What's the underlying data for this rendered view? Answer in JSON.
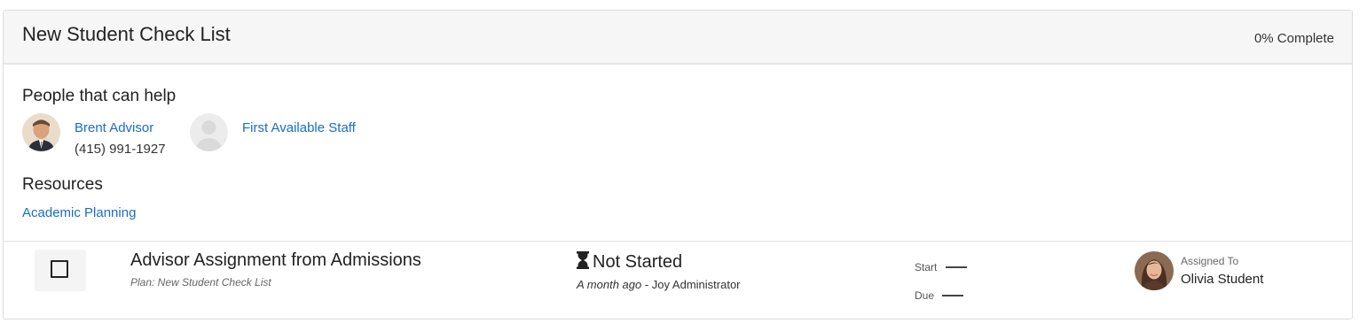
{
  "card": {
    "title": "New Student Check List",
    "progress": "0% Complete"
  },
  "people": {
    "heading": "People that can help",
    "items": [
      {
        "name": "Brent Advisor",
        "phone": "(415) 991-1927",
        "avatar": "advisor-photo"
      },
      {
        "name": "First Available Staff",
        "avatar": "placeholder-person-icon"
      }
    ]
  },
  "resources": {
    "heading": "Resources",
    "items": [
      {
        "label": "Academic Planning"
      }
    ]
  },
  "task": {
    "title": "Advisor Assignment from Admissions",
    "plan": "Plan: New Student Check List",
    "status": "Not Started",
    "status_icon": "hourglass-icon",
    "when": "A month ago",
    "separator": " - ",
    "by": "Joy Administrator",
    "start_label": "Start",
    "due_label": "Due",
    "assigned_label": "Assigned To",
    "assignee": "Olivia Student"
  }
}
